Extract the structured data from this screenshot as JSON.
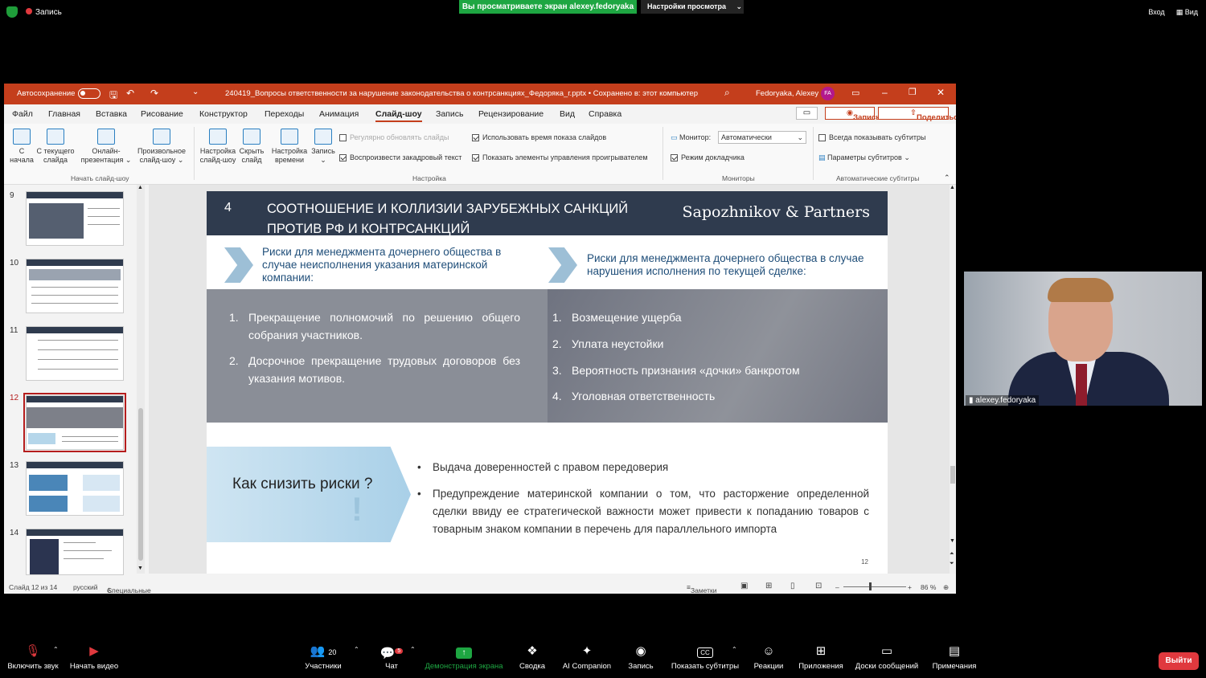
{
  "zoom": {
    "recording_label": "Запись",
    "share_banner": "Вы просматриваете экран alexey.fedoryaka",
    "view_settings": "Настройки просмотра",
    "top_right": [
      "Вход",
      "Вид"
    ],
    "participant_count": "20",
    "chat_badge": "5",
    "bottom_items": [
      "Включить звук",
      "Начать видео",
      "Участники",
      "Чат",
      "Демонстрация экрана",
      "Сводка",
      "AI Companion",
      "Запись",
      "Показать субтитры",
      "Реакции",
      "Приложения",
      "Доски сообщений",
      "Примечания"
    ],
    "leave_label": "Выйти",
    "cam_name": "alexey.fedoryaka",
    "share_color": "#1ea642",
    "leave_color": "#e0393e"
  },
  "ppt": {
    "autosave": "Автосохранение",
    "file_title": "240419_Вопросы ответственности за нарушение законодательства о контрсанкциях_Федоряка_г.pptx • Сохранено в: этот компьютер",
    "user_name": "Fedoryaka, Alexey",
    "user_initials": "FA",
    "accent": "#c43e1c",
    "menu": [
      "Файл",
      "Главная",
      "Вставка",
      "Рисование",
      "Конструктор",
      "Переходы",
      "Анимация",
      "Слайд-шоу",
      "Запись",
      "Рецензирование",
      "Вид",
      "Справка"
    ],
    "menu_active": "Слайд-шоу",
    "record_btn": "Запись",
    "share_btn": "Поделиться",
    "ribbon": {
      "start_from_beginning": [
        "С",
        "начала"
      ],
      "from_current": [
        "С текущего",
        "слайда"
      ],
      "online": [
        "Онлайн-",
        "презентация"
      ],
      "custom": [
        "Произвольное",
        "слайд-шоу"
      ],
      "group1": "Начать слайд-шоу",
      "setup": [
        "Настройка",
        "слайд-шоу"
      ],
      "hide": [
        "Скрыть",
        "слайд"
      ],
      "rehearse": [
        "Настройка",
        "времени"
      ],
      "record": "Запись",
      "chk_refresh": "Регулярно обновлять слайды",
      "chk_narration": "Воспроизвести закадровый текст",
      "chk_timings": "Использовать время показа слайдов",
      "chk_controls": "Показать элементы управления проигрывателем",
      "group2": "Настройка",
      "monitor_label": "Монитор:",
      "monitor_value": "Автоматически",
      "presenter_view": "Режим докладчика",
      "group3": "Мониторы",
      "always_subtitles": "Всегда показывать субтитры",
      "subtitle_settings": "Параметры субтитров",
      "group4": "Автоматические субтитры"
    },
    "thumb_numbers": [
      "9",
      "10",
      "11",
      "12",
      "13",
      "14"
    ],
    "status": {
      "slide_of": "Слайд 12 из 14",
      "language": "русский",
      "accessibility": "Специальные возможности: проверьте рекомендации",
      "notes": "Заметки",
      "zoom": "86 %"
    }
  },
  "slide": {
    "number": "4",
    "title": "СООТНОШЕНИЕ И КОЛЛИЗИИ ЗАРУБЕЖНЫХ САНКЦИЙ ПРОТИВ РФ И КОНТРСАНКЦИЙ",
    "brand": "Sapozhnikov & Partners",
    "left_heading": "Риски для менеджмента дочернего общества в случае неисполнения указания материнской компании:",
    "right_heading": "Риски для менеджмента дочернего общества в случае нарушения исполнения по текущей сделке:",
    "left_items": [
      {
        "n": "1.",
        "t": "Прекращение полномочий по решению общего собрания участников."
      },
      {
        "n": "2.",
        "t": "Досрочное прекращение трудовых договоров без указания мотивов."
      }
    ],
    "right_items": [
      {
        "n": "1.",
        "t": "Возмещение ущерба"
      },
      {
        "n": "2.",
        "t": "Уплата неустойки"
      },
      {
        "n": "3.",
        "t": "Вероятность признания «дочки» банкротом"
      },
      {
        "n": "4.",
        "t": "Уголовная ответственность"
      }
    ],
    "howto": "Как снизить риски ?",
    "bullets": [
      "Выдача доверенностей с правом передоверия",
      "Предупреждение материнской компании о том, что расторжение определенной сделки ввиду ее стратегической важности может привести к попаданию товаров с товарным знаком компании в перечень для параллельного импорта"
    ],
    "page": "12"
  }
}
